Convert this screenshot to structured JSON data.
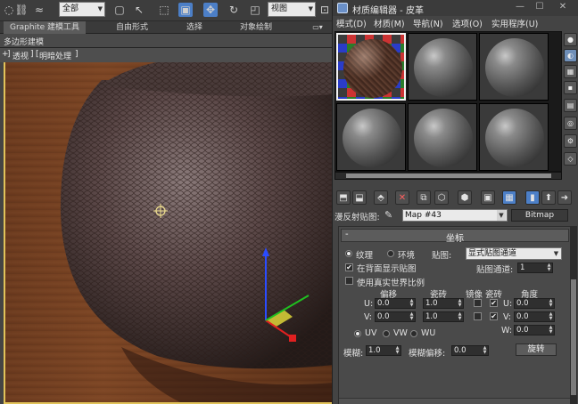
{
  "main_toolbar": {
    "selection_filter": "全部",
    "ref_coord": "视图"
  },
  "ribbon": {
    "tabs": [
      "Graphite 建模工具",
      "自由形式",
      "选择",
      "对象绘制"
    ],
    "panel_label": "多边形建模"
  },
  "viewport": {
    "labels": [
      "+",
      "]",
      "透视",
      "]",
      "[",
      "明暗处理",
      "]"
    ]
  },
  "material_editor": {
    "title": "材质编辑器 - 皮革",
    "menu": [
      "模式(D)",
      "材质(M)",
      "导航(N)",
      "选项(O)",
      "实用程序(U)"
    ],
    "map_label": "漫反射贴图:",
    "map_name": "Map #43",
    "map_type": "Bitmap",
    "rollout": {
      "sign": "-",
      "title": "坐标",
      "texture_label": "纹理",
      "environ_label": "环境",
      "mapping_label": "贴图:",
      "mapping_value": "显式贴图通道",
      "show_on_back_label": "在背面显示贴图",
      "show_on_back_checked": true,
      "map_channel_label": "贴图通道:",
      "map_channel_value": "1",
      "real_world_label": "使用真实世界比例",
      "real_world_checked": false,
      "headers": {
        "offset": "偏移",
        "tiling": "瓷砖",
        "mirror": "镜像",
        "tile": "瓷砖",
        "angle": "角度"
      },
      "u_label": "U:",
      "v_label": "V:",
      "w_label": "W:",
      "u_offset": "0.0",
      "v_offset": "0.0",
      "u_tiling": "1.0",
      "v_tiling": "1.0",
      "u_mirror": false,
      "v_mirror": false,
      "u_tile": true,
      "v_tile": true,
      "u_angle": "0.0",
      "v_angle": "0.0",
      "w_angle": "0.0",
      "uv_label": "UV",
      "vw_label": "VW",
      "wu_label": "WU",
      "blur_label": "模糊:",
      "blur_value": "1.0",
      "blur_offset_label": "模糊偏移:",
      "blur_offset_value": "0.0",
      "rotate_label": "旋转"
    }
  },
  "colors": {
    "viewport_border": "#e1c35a",
    "selected_tool": "#4c7fc7"
  }
}
